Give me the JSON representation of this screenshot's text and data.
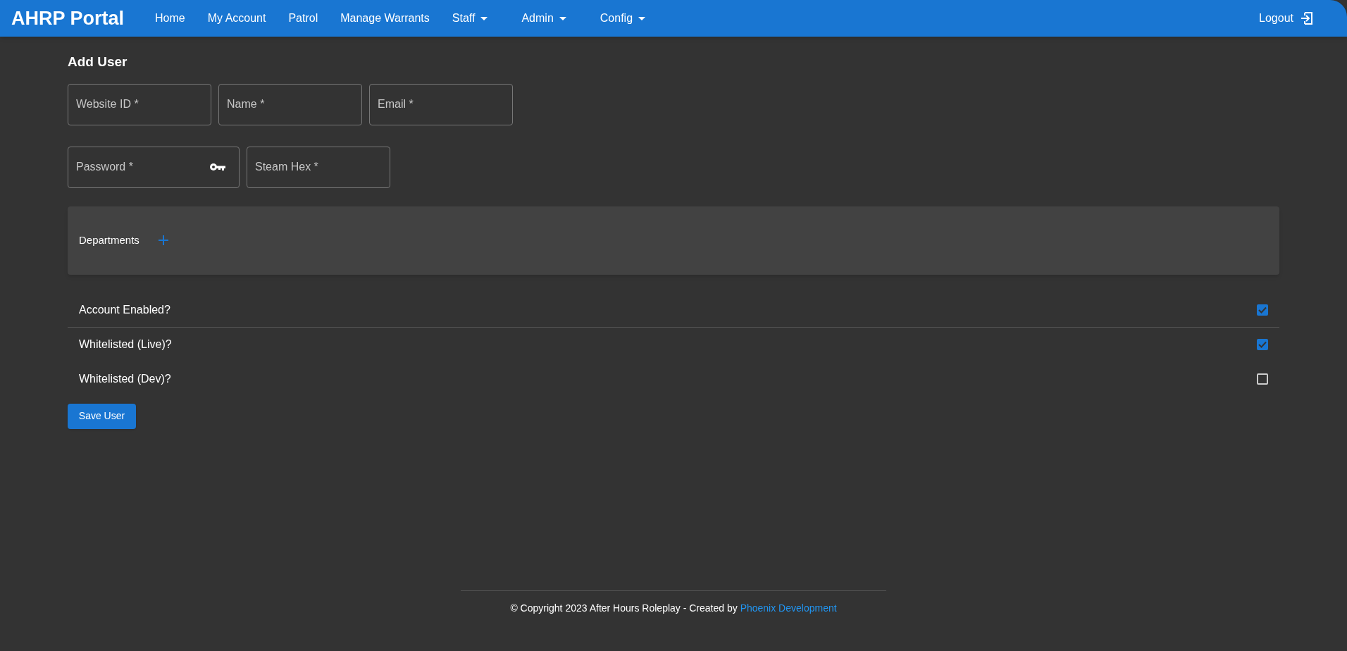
{
  "brand": "AHRP Portal",
  "nav": [
    {
      "label": "Home",
      "kind": "link"
    },
    {
      "label": "My Account",
      "kind": "link"
    },
    {
      "label": "Patrol",
      "kind": "link"
    },
    {
      "label": "Manage Warrants",
      "kind": "link"
    },
    {
      "label": "Staff",
      "kind": "dropdown"
    },
    {
      "label": "Admin",
      "kind": "dropdown"
    },
    {
      "label": "Config",
      "kind": "dropdown"
    }
  ],
  "logout": "Logout",
  "page_title": "Add User",
  "field_rows": [
    [
      {
        "placeholder": "Website ID *",
        "kind": "text"
      },
      {
        "placeholder": "Name *",
        "kind": "text"
      },
      {
        "placeholder": "Email *",
        "kind": "text"
      }
    ],
    [
      {
        "placeholder": "Password *",
        "kind": "password"
      },
      {
        "placeholder": "Steam Hex *",
        "kind": "text"
      }
    ]
  ],
  "departments": {
    "label": "Departments"
  },
  "options": [
    {
      "label": "Account Enabled?",
      "checked": true
    },
    {
      "label": "Whitelisted (Live)?",
      "checked": true
    },
    {
      "label": "Whitelisted (Dev)?",
      "checked": false
    }
  ],
  "save_button": "Save User",
  "footer": {
    "text": "© Copyright 2023 After Hours Roleplay - Created by",
    "link": "Phoenix Development"
  }
}
